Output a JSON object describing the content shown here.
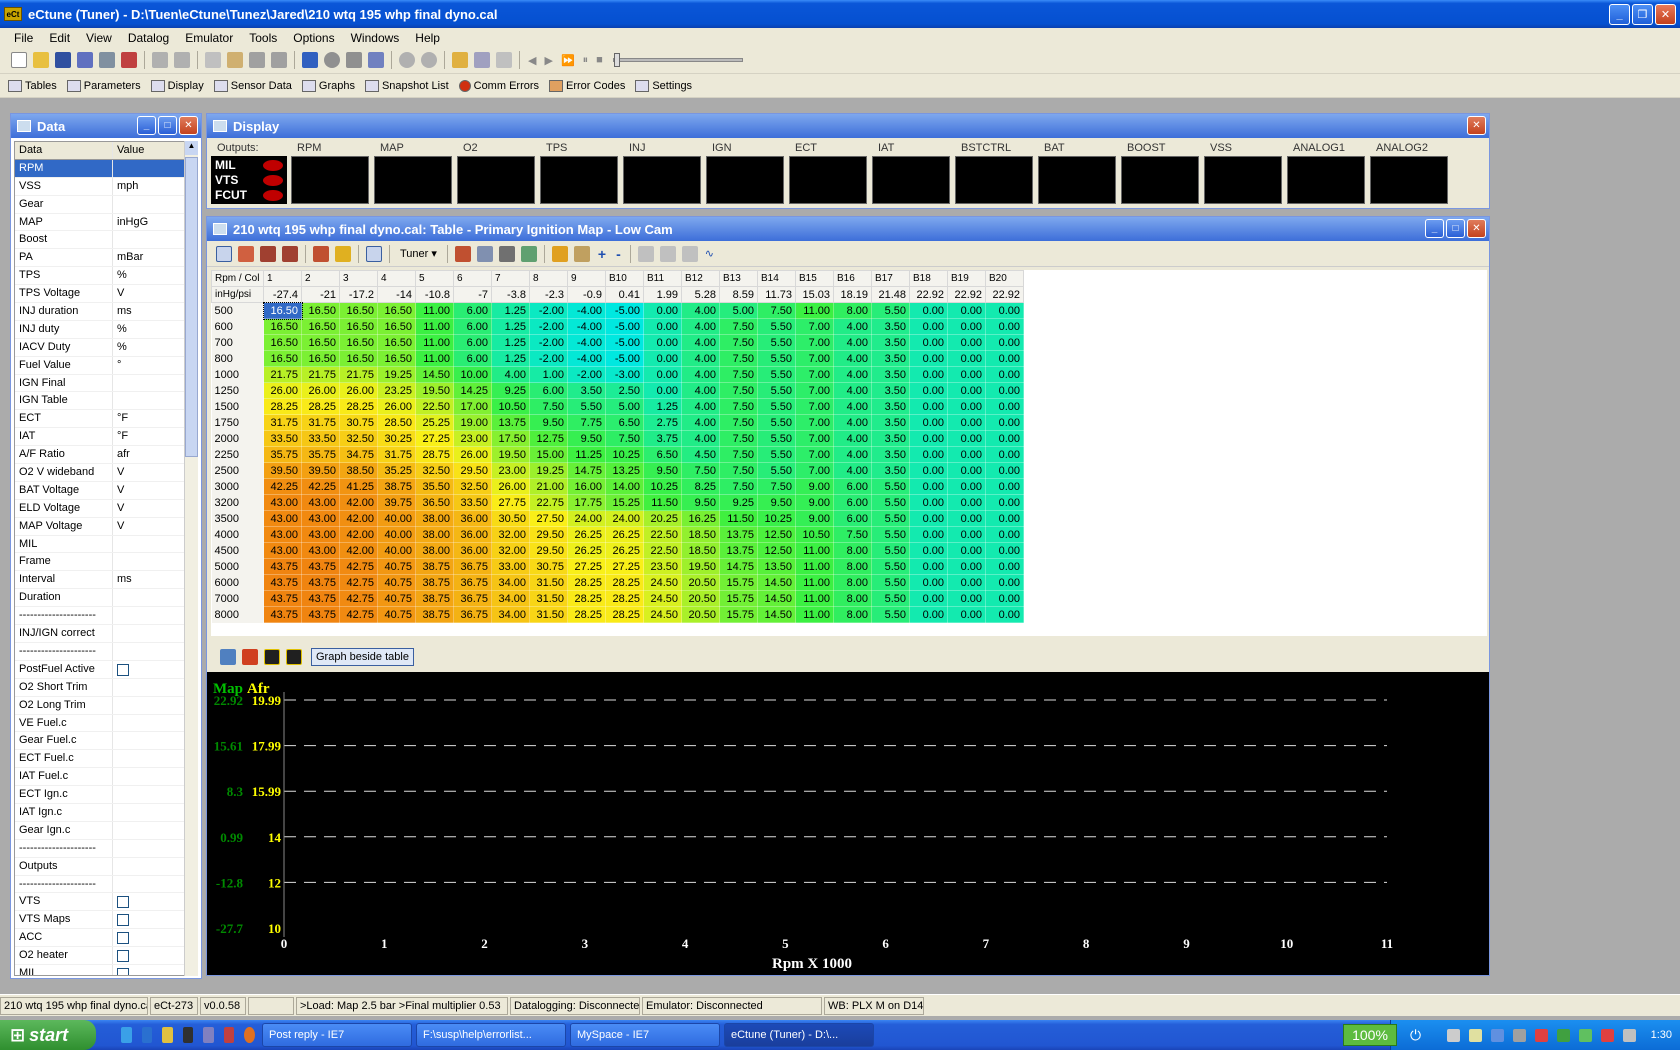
{
  "window": {
    "title": "eCtune (Tuner) - D:\\Tuen\\eCtune\\Tunez\\Jared\\210 wtq 195 whp final dyno.cal"
  },
  "menu": [
    "File",
    "Edit",
    "View",
    "Datalog",
    "Emulator",
    "Tools",
    "Options",
    "Windows",
    "Help"
  ],
  "toolbar2": [
    "Tables",
    "Parameters",
    "Display",
    "Sensor Data",
    "Graphs",
    "Snapshot List",
    "Comm Errors",
    "Error Codes",
    "Settings"
  ],
  "data_panel": {
    "title": "Data",
    "col_data": "Data",
    "col_value": "Value",
    "rows": [
      {
        "label": "RPM",
        "value": ""
      },
      {
        "label": "VSS",
        "value": "mph"
      },
      {
        "label": "Gear",
        "value": ""
      },
      {
        "label": "MAP",
        "value": "inHgG"
      },
      {
        "label": "Boost",
        "value": ""
      },
      {
        "label": "PA",
        "value": "mBar"
      },
      {
        "label": "TPS",
        "value": "%"
      },
      {
        "label": "TPS Voltage",
        "value": "V"
      },
      {
        "label": "INJ duration",
        "value": "ms"
      },
      {
        "label": "INJ duty",
        "value": "%"
      },
      {
        "label": "IACV Duty",
        "value": "%"
      },
      {
        "label": "Fuel Value",
        "value": "°"
      },
      {
        "label": "IGN Final",
        "value": ""
      },
      {
        "label": "IGN Table",
        "value": ""
      },
      {
        "label": "ECT",
        "value": "°F"
      },
      {
        "label": "IAT",
        "value": "°F"
      },
      {
        "label": "A/F Ratio",
        "value": "afr"
      },
      {
        "label": "O2 V wideband",
        "value": "V"
      },
      {
        "label": "BAT Voltage",
        "value": "V"
      },
      {
        "label": "ELD Voltage",
        "value": "V"
      },
      {
        "label": "MAP Voltage",
        "value": "V"
      },
      {
        "label": "MIL",
        "value": ""
      },
      {
        "label": "Frame",
        "value": ""
      },
      {
        "label": "Interval",
        "value": "ms"
      },
      {
        "label": "Duration",
        "value": ""
      },
      {
        "label": "---------------------",
        "value": ""
      },
      {
        "label": "INJ/IGN correct",
        "value": ""
      },
      {
        "label": "---------------------",
        "value": ""
      },
      {
        "label": "PostFuel Active",
        "value": "checkbox"
      },
      {
        "label": "O2 Short Trim",
        "value": ""
      },
      {
        "label": "O2 Long Trim",
        "value": ""
      },
      {
        "label": "VE Fuel.c",
        "value": ""
      },
      {
        "label": "Gear Fuel.c",
        "value": ""
      },
      {
        "label": "ECT Fuel.c",
        "value": ""
      },
      {
        "label": "IAT Fuel.c",
        "value": ""
      },
      {
        "label": "ECT Ign.c",
        "value": ""
      },
      {
        "label": "IAT Ign.c",
        "value": ""
      },
      {
        "label": "Gear Ign.c",
        "value": ""
      },
      {
        "label": "---------------------",
        "value": ""
      },
      {
        "label": "Outputs",
        "value": ""
      },
      {
        "label": "---------------------",
        "value": ""
      },
      {
        "label": "VTS",
        "value": "checkbox"
      },
      {
        "label": "VTS Maps",
        "value": "checkbox"
      },
      {
        "label": "ACC",
        "value": "checkbox"
      },
      {
        "label": "O2 heater",
        "value": "checkbox"
      },
      {
        "label": "MIL",
        "value": "checkbox"
      }
    ]
  },
  "display_panel": {
    "title": "Display",
    "outputs_label": "Outputs:",
    "outputs": [
      "MIL",
      "VTS",
      "FCUT"
    ],
    "gauges": [
      "RPM",
      "MAP",
      "O2",
      "TPS",
      "INJ",
      "IGN",
      "ECT",
      "IAT",
      "BSTCTRL",
      "BAT",
      "BOOST",
      "VSS",
      "ANALOG1",
      "ANALOG2"
    ]
  },
  "table_window": {
    "title": "210 wtq 195 whp final dyno.cal: Table - Primary Ignition Map - Low Cam",
    "tuner_dropdown": "Tuner",
    "corner_label": "Rpm / Col",
    "load_label": "inHg/psi",
    "col_headers": [
      "1",
      "2",
      "3",
      "4",
      "5",
      "6",
      "7",
      "8",
      "9",
      "B10",
      "B11",
      "B12",
      "B13",
      "B14",
      "B15",
      "B16",
      "B17",
      "B18",
      "B19",
      "B20"
    ],
    "load_values": [
      "-27.4",
      "-21",
      "-17.2",
      "-14",
      "-10.8",
      "-7",
      "-3.8",
      "-2.3",
      "-0.9",
      "0.41",
      "1.99",
      "5.28",
      "8.59",
      "11.73",
      "15.03",
      "18.19",
      "21.48",
      "22.92",
      "22.92",
      "22.92"
    ],
    "rows": [
      {
        "rpm": "500",
        "v": [
          16.5,
          16.5,
          16.5,
          16.5,
          11.0,
          6.0,
          1.25,
          -2.0,
          -4.0,
          -5.0,
          0.0,
          4.0,
          5.0,
          7.5,
          11.0,
          8.0,
          5.5,
          0.0,
          0.0,
          0.0
        ]
      },
      {
        "rpm": "600",
        "v": [
          16.5,
          16.5,
          16.5,
          16.5,
          11.0,
          6.0,
          1.25,
          -2.0,
          -4.0,
          -5.0,
          0.0,
          4.0,
          7.5,
          5.5,
          7.0,
          4.0,
          3.5,
          0.0,
          0.0,
          0.0
        ]
      },
      {
        "rpm": "700",
        "v": [
          16.5,
          16.5,
          16.5,
          16.5,
          11.0,
          6.0,
          1.25,
          -2.0,
          -4.0,
          -5.0,
          0.0,
          4.0,
          7.5,
          5.5,
          7.0,
          4.0,
          3.5,
          0.0,
          0.0,
          0.0
        ]
      },
      {
        "rpm": "800",
        "v": [
          16.5,
          16.5,
          16.5,
          16.5,
          11.0,
          6.0,
          1.25,
          -2.0,
          -4.0,
          -5.0,
          0.0,
          4.0,
          7.5,
          5.5,
          7.0,
          4.0,
          3.5,
          0.0,
          0.0,
          0.0
        ]
      },
      {
        "rpm": "1000",
        "v": [
          21.75,
          21.75,
          21.75,
          19.25,
          14.5,
          10.0,
          4.0,
          1.0,
          -2.0,
          -3.0,
          0.0,
          4.0,
          7.5,
          5.5,
          7.0,
          4.0,
          3.5,
          0.0,
          0.0,
          0.0
        ]
      },
      {
        "rpm": "1250",
        "v": [
          26.0,
          26.0,
          26.0,
          23.25,
          19.5,
          14.25,
          9.25,
          6.0,
          3.5,
          2.5,
          0.0,
          4.0,
          7.5,
          5.5,
          7.0,
          4.0,
          3.5,
          0.0,
          0.0,
          0.0
        ]
      },
      {
        "rpm": "1500",
        "v": [
          28.25,
          28.25,
          28.25,
          26.0,
          22.5,
          17.0,
          10.5,
          7.5,
          5.5,
          5.0,
          1.25,
          4.0,
          7.5,
          5.5,
          7.0,
          4.0,
          3.5,
          0.0,
          0.0,
          0.0
        ]
      },
      {
        "rpm": "1750",
        "v": [
          31.75,
          31.75,
          30.75,
          28.5,
          25.25,
          19.0,
          13.75,
          9.5,
          7.75,
          6.5,
          2.75,
          4.0,
          7.5,
          5.5,
          7.0,
          4.0,
          3.5,
          0.0,
          0.0,
          0.0
        ]
      },
      {
        "rpm": "2000",
        "v": [
          33.5,
          33.5,
          32.5,
          30.25,
          27.25,
          23.0,
          17.5,
          12.75,
          9.5,
          7.5,
          3.75,
          4.0,
          7.5,
          5.5,
          7.0,
          4.0,
          3.5,
          0.0,
          0.0,
          0.0
        ]
      },
      {
        "rpm": "2250",
        "v": [
          35.75,
          35.75,
          34.75,
          31.75,
          28.75,
          26.0,
          19.5,
          15.0,
          11.25,
          10.25,
          6.5,
          4.5,
          7.5,
          5.5,
          7.0,
          4.0,
          3.5,
          0.0,
          0.0,
          0.0
        ]
      },
      {
        "rpm": "2500",
        "v": [
          39.5,
          39.5,
          38.5,
          35.25,
          32.5,
          29.5,
          23.0,
          19.25,
          14.75,
          13.25,
          9.5,
          7.5,
          7.5,
          5.5,
          7.0,
          4.0,
          3.5,
          0.0,
          0.0,
          0.0
        ]
      },
      {
        "rpm": "3000",
        "v": [
          42.25,
          42.25,
          41.25,
          38.75,
          35.5,
          32.5,
          26.0,
          21.0,
          16.0,
          14.0,
          10.25,
          8.25,
          7.5,
          7.5,
          9.0,
          6.0,
          5.5,
          0.0,
          0.0,
          0.0
        ]
      },
      {
        "rpm": "3200",
        "v": [
          43.0,
          43.0,
          42.0,
          39.75,
          36.5,
          33.5,
          27.75,
          22.75,
          17.75,
          15.25,
          11.5,
          9.5,
          9.25,
          9.5,
          9.0,
          6.0,
          5.5,
          0.0,
          0.0,
          0.0
        ]
      },
      {
        "rpm": "3500",
        "v": [
          43.0,
          43.0,
          42.0,
          40.0,
          38.0,
          36.0,
          30.5,
          27.5,
          24.0,
          24.0,
          20.25,
          16.25,
          11.5,
          10.25,
          9.0,
          6.0,
          5.5,
          0.0,
          0.0,
          0.0
        ]
      },
      {
        "rpm": "4000",
        "v": [
          43.0,
          43.0,
          42.0,
          40.0,
          38.0,
          36.0,
          32.0,
          29.5,
          26.25,
          26.25,
          22.5,
          18.5,
          13.75,
          12.5,
          10.5,
          7.5,
          5.5,
          0.0,
          0.0,
          0.0
        ]
      },
      {
        "rpm": "4500",
        "v": [
          43.0,
          43.0,
          42.0,
          40.0,
          38.0,
          36.0,
          32.0,
          29.5,
          26.25,
          26.25,
          22.5,
          18.5,
          13.75,
          12.5,
          11.0,
          8.0,
          5.5,
          0.0,
          0.0,
          0.0
        ]
      },
      {
        "rpm": "5000",
        "v": [
          43.75,
          43.75,
          42.75,
          40.75,
          38.75,
          36.75,
          33.0,
          30.75,
          27.25,
          27.25,
          23.5,
          19.5,
          14.75,
          13.5,
          11.0,
          8.0,
          5.5,
          0.0,
          0.0,
          0.0
        ]
      },
      {
        "rpm": "6000",
        "v": [
          43.75,
          43.75,
          42.75,
          40.75,
          38.75,
          36.75,
          34.0,
          31.5,
          28.25,
          28.25,
          24.5,
          20.5,
          15.75,
          14.5,
          11.0,
          8.0,
          5.5,
          0.0,
          0.0,
          0.0
        ]
      },
      {
        "rpm": "7000",
        "v": [
          43.75,
          43.75,
          42.75,
          40.75,
          38.75,
          36.75,
          34.0,
          31.5,
          28.25,
          28.25,
          24.5,
          20.5,
          15.75,
          14.5,
          11.0,
          8.0,
          5.5,
          0.0,
          0.0,
          0.0
        ]
      },
      {
        "rpm": "8000",
        "v": [
          43.75,
          43.75,
          42.75,
          40.75,
          38.75,
          36.75,
          34.0,
          31.5,
          28.25,
          28.25,
          24.5,
          20.5,
          15.75,
          14.5,
          11.0,
          8.0,
          5.5,
          0.0,
          0.0,
          0.0
        ]
      }
    ],
    "graph_beside_table": "Graph beside table"
  },
  "chart_data": {
    "type": "line",
    "title": "",
    "legend": [
      "Map",
      "Afr"
    ],
    "y_left_ticks": [
      "22.92",
      "15.61",
      "8.3",
      "0.99",
      "-12.8",
      "-27.7"
    ],
    "y_right_ticks": [
      "19.99",
      "17.99",
      "15.99",
      "14",
      "12",
      "10"
    ],
    "x_ticks": [
      "0",
      "1",
      "2",
      "3",
      "4",
      "5",
      "6",
      "7",
      "8",
      "9",
      "10",
      "11"
    ],
    "xlabel": "Rpm X 1000",
    "xlim": [
      0,
      11
    ],
    "grid": true,
    "series": []
  },
  "statusbar": [
    "210 wtq 195 whp final dyno.cal",
    "eCt-273",
    "v0.0.58",
    "",
    ">Load: Map 2.5 bar >Final multiplier 0.53",
    "Datalogging: Disconnected",
    "Emulator: Disconnected",
    "WB: PLX M on D14"
  ],
  "taskbar": {
    "start": "start",
    "tasks": [
      "Post reply - IE7",
      "F:\\susp\\help\\errorlist...",
      "MySpace - IE7",
      "eCtune (Tuner) - D:\\..."
    ],
    "zoom": "100%",
    "clock": "1:30"
  },
  "colors": {
    "titlebar": "#0550d0",
    "selected": "#3169c6",
    "cell_low": "#00e8e0",
    "cell_high": "#f08010"
  }
}
